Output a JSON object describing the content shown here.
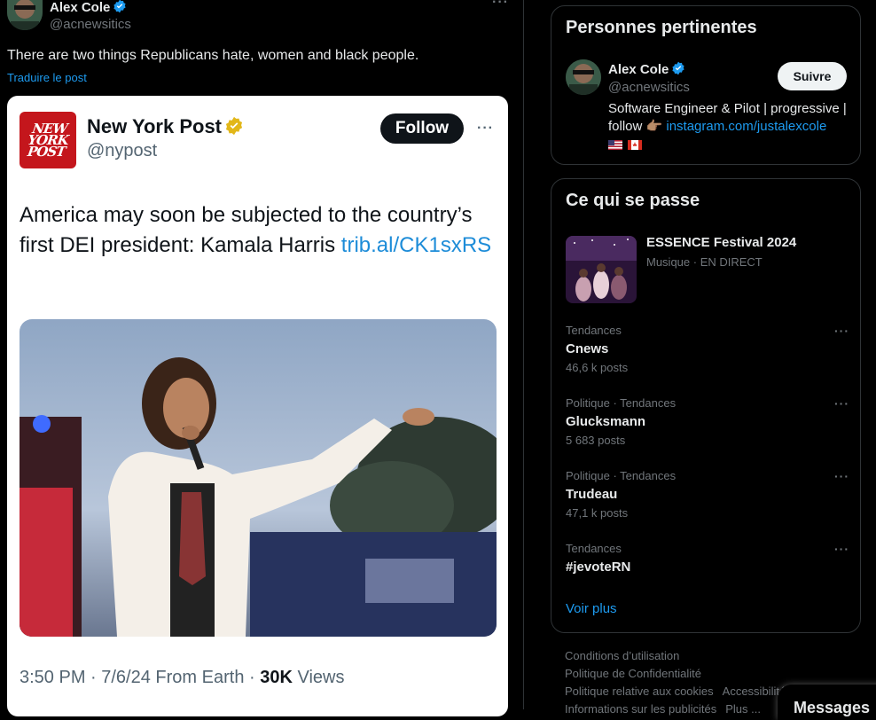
{
  "post": {
    "author_name": "Alex Cole",
    "author_handle": "@acnewsitics",
    "text": "There are two things Republicans hate, women and black people.",
    "translate_label": "Traduire le post",
    "more_icon": "more-horizontal-icon"
  },
  "embedded": {
    "logo_text": "NEW YORK POST",
    "name": "New York Post",
    "handle": "@nypost",
    "follow_label": "Follow",
    "text_before": "America may soon be subjected to the country’s first DEI president: Kamala Harris ",
    "link_text": "trib.al/CK1sxRS",
    "time": "3:50 PM · 7/6/24 From Earth · ",
    "views_count": "30K",
    "views_label": " Views"
  },
  "relevant": {
    "title": "Personnes pertinentes",
    "name": "Alex Cole",
    "handle": "@acnewsitics",
    "follow_label": "Suivre",
    "bio_text": "Software Engineer & Pilot | progressive | follow 👉🏽 ",
    "bio_link": "instagram.com/justalexcole"
  },
  "happening": {
    "title": "Ce qui se passe",
    "event": {
      "title": "ESSENCE Festival 2024",
      "subtitle": "Musique · EN DIRECT"
    },
    "trends": [
      {
        "category": "Tendances",
        "name": "Cnews",
        "count": "46,6 k posts"
      },
      {
        "category": "Politique · Tendances",
        "name": "Glucksmann",
        "count": "5 683 posts"
      },
      {
        "category": "Politique · Tendances",
        "name": "Trudeau",
        "count": "47,1 k posts"
      },
      {
        "category": "Tendances",
        "name": "#jevoteRN",
        "count": ""
      }
    ],
    "see_more": "Voir plus"
  },
  "footer": {
    "links": [
      "Conditions d’utilisation",
      "Politique de Confidentialité",
      "Politique relative aux cookies",
      "Accessibilité",
      "Informations sur les publicités",
      "Plus ..."
    ]
  },
  "messages_label": "Messages",
  "colors": {
    "accent": "#1d9bf0",
    "nypost_red": "#c4161c",
    "verified_gold": "#e2b719"
  }
}
